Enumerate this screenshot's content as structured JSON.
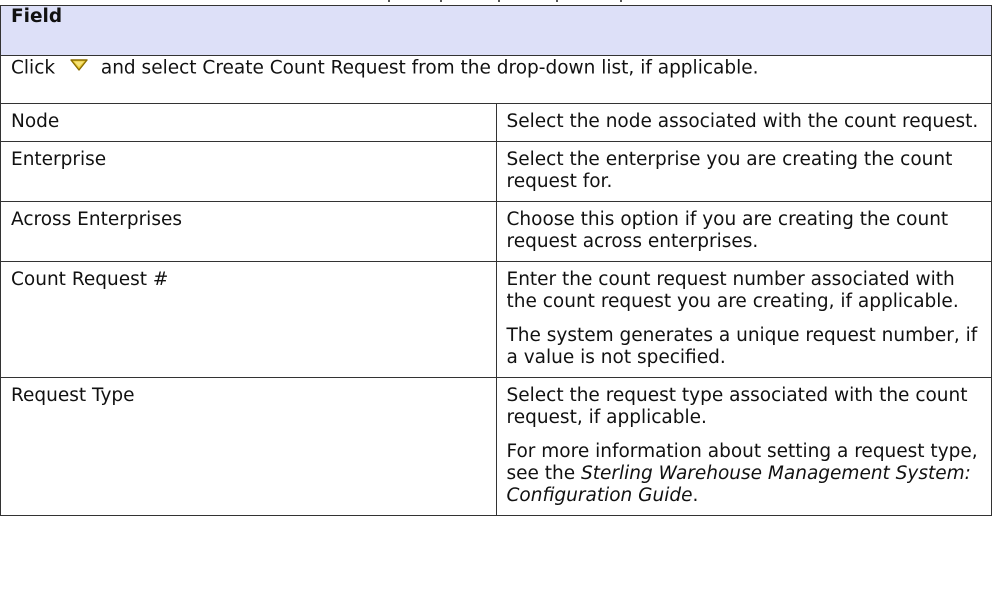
{
  "table": {
    "header": "Field",
    "intro": {
      "prefix": "Click",
      "icon": "dropdown-arrow-icon",
      "suffix": "and select Create Count Request from the drop-down list, if applicable."
    },
    "rows": [
      {
        "field": "Node",
        "paragraphs": [
          "Select the node associated with the count request."
        ]
      },
      {
        "field": "Enterprise",
        "paragraphs": [
          "Select the enterprise you are creating the count request for."
        ]
      },
      {
        "field": "Across Enterprises",
        "paragraphs": [
          "Choose this option if you are creating the count request across enterprises."
        ]
      },
      {
        "field": "Count Request #",
        "paragraphs": [
          "Enter the count request number associated with the count request you are creating, if applicable.",
          "The system generates a unique request number, if a value is not specified."
        ]
      },
      {
        "field": "Request Type",
        "paragraphs": [
          "Select the request type associated with the count request, if applicable."
        ],
        "reference": {
          "prefix": "For more information about setting a request type, see the",
          "title": "Sterling Warehouse Management System: Configuration Guide",
          "suffix": "."
        }
      }
    ]
  },
  "colors": {
    "header_bg": "#dde0f8",
    "icon_fill": "#e8c832",
    "icon_stroke": "#8a6d00",
    "border": "#333333"
  }
}
